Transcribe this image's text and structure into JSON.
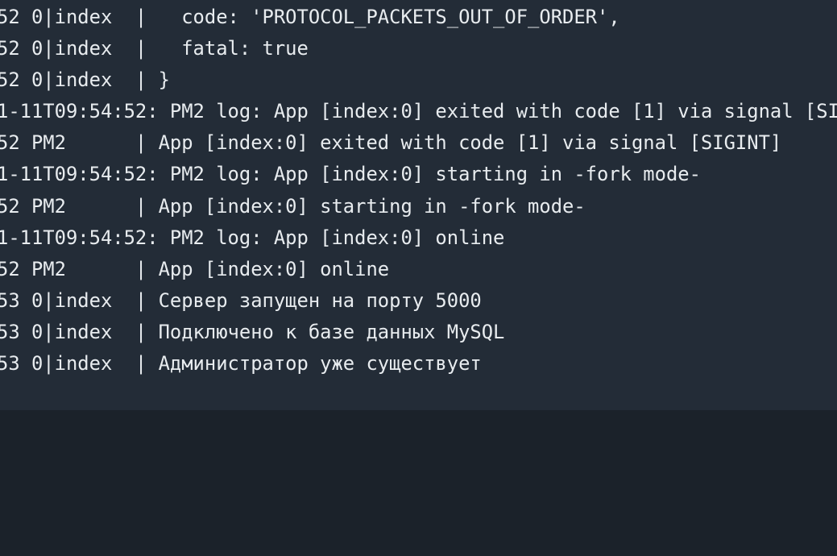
{
  "terminal": {
    "lines": [
      "52 0|index  |   code: 'PROTOCOL_PACKETS_OUT_OF_ORDER',",
      "52 0|index  |   fatal: true",
      "52 0|index  | }",
      "1-11T09:54:52: PM2 log: App [index:0] exited with code [1] via signal [SI",
      "52 PM2      | App [index:0] exited with code [1] via signal [SIGINT]",
      "1-11T09:54:52: PM2 log: App [index:0] starting in -fork mode-",
      "52 PM2      | App [index:0] starting in -fork mode-",
      "1-11T09:54:52: PM2 log: App [index:0] online",
      "52 PM2      | App [index:0] online",
      "53 0|index  | Сервер запущен на порту 5000",
      "53 0|index  | Подключено к базе данных MySQL",
      "53 0|index  | Администратор уже существует"
    ]
  }
}
